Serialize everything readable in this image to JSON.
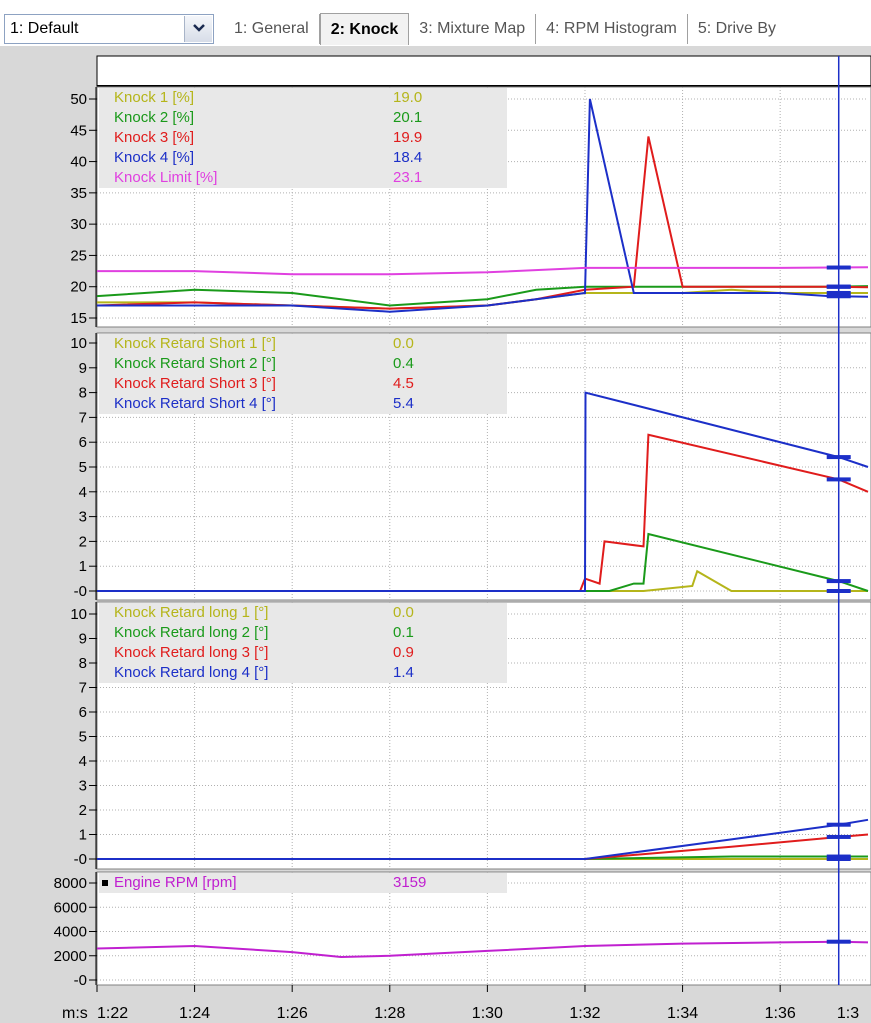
{
  "profile_combo": {
    "value": "1: Default"
  },
  "tabs": [
    {
      "label": "1: General",
      "active": false
    },
    {
      "label": "2: Knock",
      "active": true
    },
    {
      "label": "3: Mixture Map",
      "active": false
    },
    {
      "label": "4: RPM Histogram",
      "active": false
    },
    {
      "label": "5: Drive By",
      "active": false
    }
  ],
  "x_axis": {
    "unit_label": "m:s",
    "ticks": [
      "1:22",
      "1:24",
      "1:26",
      "1:28",
      "1:30",
      "1:32",
      "1:34",
      "1:36",
      "1:3"
    ]
  },
  "cursor": {
    "time": "1:37.2"
  },
  "panels": [
    {
      "id": "knock",
      "y_ticks": [
        "50",
        "45",
        "40",
        "35",
        "30",
        "25",
        "20",
        "15"
      ],
      "legend": [
        {
          "label": "Knock 1 [%]",
          "value": "19.0",
          "color": "#b5b51a"
        },
        {
          "label": "Knock 2 [%]",
          "value": "20.1",
          "color": "#1a9a1a"
        },
        {
          "label": "Knock 3 [%]",
          "value": "19.9",
          "color": "#e01c1c"
        },
        {
          "label": "Knock 4 [%]",
          "value": "18.4",
          "color": "#1c2fc8"
        },
        {
          "label": "Knock Limit [%]",
          "value": "23.1",
          "color": "#e040e0"
        }
      ]
    },
    {
      "id": "retard-short",
      "y_ticks": [
        "10",
        "9",
        "8",
        "7",
        "6",
        "5",
        "4",
        "3",
        "2",
        "1",
        "-0"
      ],
      "legend": [
        {
          "label": "Knock Retard Short 1 [°]",
          "value": "0.0",
          "color": "#b5b51a"
        },
        {
          "label": "Knock Retard Short 2 [°]",
          "value": "0.4",
          "color": "#1a9a1a"
        },
        {
          "label": "Knock Retard Short 3 [°]",
          "value": "4.5",
          "color": "#e01c1c"
        },
        {
          "label": "Knock Retard Short 4 [°]",
          "value": "5.4",
          "color": "#1c2fc8"
        }
      ]
    },
    {
      "id": "retard-long",
      "y_ticks": [
        "10",
        "9",
        "8",
        "7",
        "6",
        "5",
        "4",
        "3",
        "2",
        "1",
        "-0"
      ],
      "legend": [
        {
          "label": "Knock Retard long 1 [°]",
          "value": "0.0",
          "color": "#b5b51a"
        },
        {
          "label": "Knock Retard long 2 [°]",
          "value": "0.1",
          "color": "#1a9a1a"
        },
        {
          "label": "Knock Retard long 3 [°]",
          "value": "0.9",
          "color": "#e01c1c"
        },
        {
          "label": "Knock Retard long 4 [°]",
          "value": "1.4",
          "color": "#1c2fc8"
        }
      ]
    },
    {
      "id": "rpm",
      "y_ticks": [
        "8000",
        "6000",
        "4000",
        "2000",
        "-0"
      ],
      "legend": [
        {
          "label": "Engine RPM [rpm]",
          "value": "3159",
          "color": "#c020d0"
        }
      ]
    }
  ],
  "chart_data": [
    {
      "type": "line",
      "ylim": [
        15,
        50
      ],
      "xlim": [
        "1:22",
        "1:37.8"
      ],
      "grid": true,
      "legend_position": "top-left",
      "series": [
        {
          "name": "Knock 1 [%]",
          "color": "#b5b51a",
          "x": [
            "1:22",
            "1:24",
            "1:26",
            "1:28",
            "1:30",
            "1:31",
            "1:32",
            "1:33",
            "1:34",
            "1:35",
            "1:36",
            "1:37",
            "1:37.8"
          ],
          "y": [
            17.5,
            17.5,
            17,
            16.5,
            17,
            18,
            19,
            19,
            19,
            19.5,
            19,
            19,
            19
          ]
        },
        {
          "name": "Knock 2 [%]",
          "color": "#1a9a1a",
          "x": [
            "1:22",
            "1:24",
            "1:26",
            "1:28",
            "1:30",
            "1:31",
            "1:32",
            "1:33",
            "1:34",
            "1:35",
            "1:36",
            "1:37",
            "1:37.8"
          ],
          "y": [
            18.5,
            19.5,
            19,
            17,
            18,
            19.5,
            20,
            20,
            20,
            20,
            20,
            20,
            20.1
          ]
        },
        {
          "name": "Knock 3 [%]",
          "color": "#e01c1c",
          "x": [
            "1:22",
            "1:24",
            "1:26",
            "1:28",
            "1:30",
            "1:31",
            "1:32",
            "1:33",
            "1:33.3",
            "1:34",
            "1:35",
            "1:36",
            "1:37",
            "1:37.8"
          ],
          "y": [
            17,
            17.5,
            17,
            16.5,
            17,
            18,
            19.5,
            20,
            44,
            20,
            20,
            20,
            20,
            19.9
          ]
        },
        {
          "name": "Knock 4 [%]",
          "color": "#1c2fc8",
          "x": [
            "1:22",
            "1:24",
            "1:26",
            "1:28",
            "1:30",
            "1:31",
            "1:32",
            "1:32.1",
            "1:33",
            "1:34",
            "1:35",
            "1:36",
            "1:37",
            "1:37.8"
          ],
          "y": [
            17,
            17,
            17,
            16,
            17,
            18,
            19,
            50,
            19,
            19,
            19,
            19,
            18.5,
            18.4
          ]
        },
        {
          "name": "Knock Limit [%]",
          "color": "#e040e0",
          "x": [
            "1:22",
            "1:24",
            "1:26",
            "1:28",
            "1:30",
            "1:32",
            "1:34",
            "1:36",
            "1:37.8"
          ],
          "y": [
            22.5,
            22.5,
            22,
            22,
            22.3,
            23,
            23,
            23,
            23.1
          ]
        }
      ]
    },
    {
      "type": "line",
      "ylim": [
        0,
        10
      ],
      "xlim": [
        "1:22",
        "1:37.8"
      ],
      "grid": true,
      "legend_position": "top-left",
      "series": [
        {
          "name": "Knock Retard Short 1 [°]",
          "color": "#b5b51a",
          "x": [
            "1:22",
            "1:33.2",
            "1:34.2",
            "1:34.3",
            "1:35",
            "1:37.8"
          ],
          "y": [
            0,
            0,
            0.2,
            0.8,
            0,
            0
          ]
        },
        {
          "name": "Knock Retard Short 2 [°]",
          "color": "#1a9a1a",
          "x": [
            "1:22",
            "1:32.5",
            "1:33",
            "1:33.2",
            "1:33.3",
            "1:37.2",
            "1:37.8"
          ],
          "y": [
            0,
            0,
            0.3,
            0.3,
            2.3,
            0.4,
            0
          ]
        },
        {
          "name": "Knock Retard Short 3 [°]",
          "color": "#e01c1c",
          "x": [
            "1:22",
            "1:31.9",
            "1:32",
            "1:32.3",
            "1:32.4",
            "1:33.2",
            "1:33.3",
            "1:37.2",
            "1:37.8"
          ],
          "y": [
            0,
            0,
            0.5,
            0.3,
            2,
            1.8,
            6.3,
            4.5,
            4
          ]
        },
        {
          "name": "Knock Retard Short 4 [°]",
          "color": "#1c2fc8",
          "x": [
            "1:22",
            "1:32",
            "1:32.01",
            "1:37.2",
            "1:37.8"
          ],
          "y": [
            0,
            0,
            8,
            5.4,
            5
          ]
        }
      ]
    },
    {
      "type": "line",
      "ylim": [
        0,
        10
      ],
      "xlim": [
        "1:22",
        "1:37.8"
      ],
      "grid": true,
      "legend_position": "top-left",
      "series": [
        {
          "name": "Knock Retard long 1 [°]",
          "color": "#b5b51a",
          "x": [
            "1:22",
            "1:37.8"
          ],
          "y": [
            0,
            0
          ]
        },
        {
          "name": "Knock Retard long 2 [°]",
          "color": "#1a9a1a",
          "x": [
            "1:22",
            "1:32",
            "1:35",
            "1:37.2",
            "1:37.8"
          ],
          "y": [
            0,
            0,
            0.1,
            0.1,
            0.1
          ]
        },
        {
          "name": "Knock Retard long 3 [°]",
          "color": "#e01c1c",
          "x": [
            "1:22",
            "1:32",
            "1:35",
            "1:37.2",
            "1:37.8"
          ],
          "y": [
            0,
            0,
            0.5,
            0.9,
            1
          ]
        },
        {
          "name": "Knock Retard long 4 [°]",
          "color": "#1c2fc8",
          "x": [
            "1:22",
            "1:32",
            "1:35",
            "1:37.2",
            "1:37.8"
          ],
          "y": [
            0,
            0,
            0.8,
            1.4,
            1.6
          ]
        }
      ]
    },
    {
      "type": "line",
      "ylim": [
        0,
        8000
      ],
      "xlim": [
        "1:22",
        "1:37.8"
      ],
      "grid": true,
      "legend_position": "top-left",
      "series": [
        {
          "name": "Engine RPM [rpm]",
          "color": "#c020d0",
          "x": [
            "1:22",
            "1:24",
            "1:26",
            "1:27",
            "1:28",
            "1:30",
            "1:32",
            "1:34",
            "1:36",
            "1:37.2",
            "1:37.8"
          ],
          "y": [
            2600,
            2800,
            2300,
            1900,
            2000,
            2400,
            2800,
            3000,
            3100,
            3159,
            3100
          ]
        }
      ]
    }
  ]
}
